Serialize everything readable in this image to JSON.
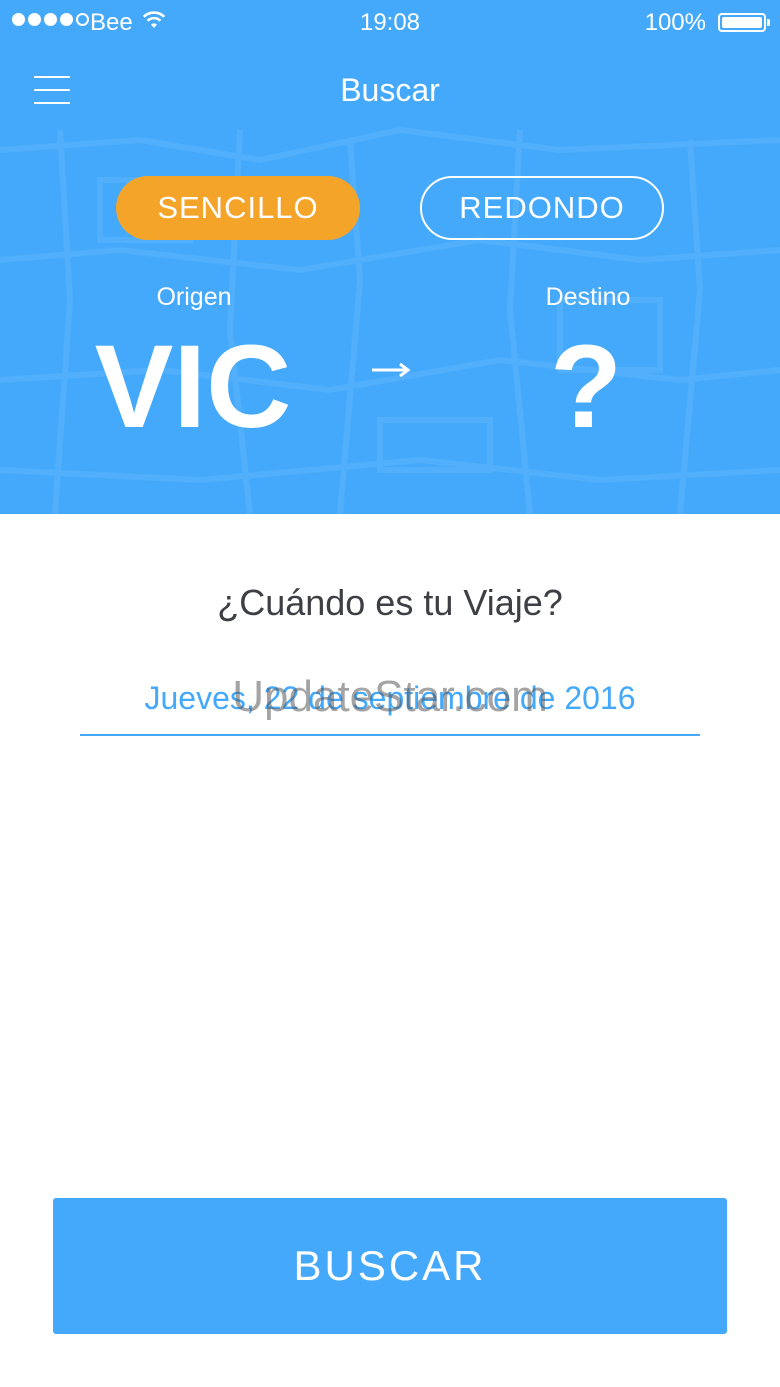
{
  "status_bar": {
    "carrier": "Bee",
    "time": "19:08",
    "battery": "100%",
    "signal_icon": "signal-dots-icon",
    "wifi_icon": "wifi-icon",
    "battery_icon": "battery-icon"
  },
  "nav": {
    "title": "Buscar",
    "menu_icon": "hamburger-menu-icon"
  },
  "trip_type": {
    "one_way_label": "SENCILLO",
    "round_trip_label": "REDONDO",
    "selected": "SENCILLO"
  },
  "route": {
    "origin_label": "Origen",
    "origin_code": "VIC",
    "destination_label": "Destino",
    "destination_code": "?",
    "arrow_icon": "arrow-right-icon"
  },
  "date": {
    "question": "¿Cuándo es tu Viaje?",
    "value": "Jueves, 22 de septiembre de 2016"
  },
  "watermark": "UpdateStar.com",
  "search_button_label": "BUSCAR",
  "colors": {
    "primary": "#45a9fb",
    "accent": "#f5a42a",
    "text_dark": "#3d3f45",
    "white": "#ffffff"
  }
}
